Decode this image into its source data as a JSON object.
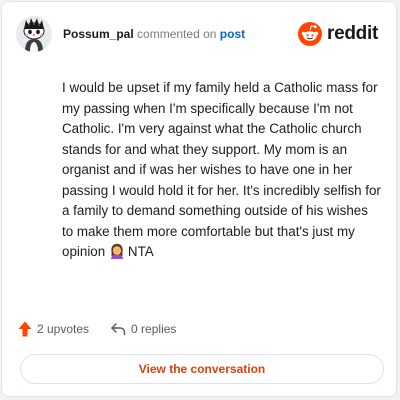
{
  "header": {
    "username": "Possum_pal",
    "action_text": "commented on",
    "target_link": "post",
    "avatar_icon": "snoo-avatar-icon",
    "brand": {
      "icon": "reddit-logo-icon",
      "wordmark": "reddit",
      "color": "#ff4500"
    }
  },
  "comment": {
    "text": "I would be upset if my family held a Catholic mass for my passing when I'm specifically because I'm not Catholic. I'm very against what the Catholic church stands for and what they support. My mom is an organist and if was her wishes to have one in her passing I would hold it for her. It's incredibly selfish for a family to demand something outside of his wishes to make them more comfortable but that's just my opinion",
    "emoji": "woman-facepalming-emoji",
    "tail": "NTA"
  },
  "actions": {
    "upvotes_label": "2 upvotes",
    "upvote_icon": "upvote-arrow-icon",
    "replies_label": "0 replies",
    "reply_icon": "reply-arrow-icon"
  },
  "cta": {
    "label": "View the conversation",
    "color": "#d9420b"
  }
}
